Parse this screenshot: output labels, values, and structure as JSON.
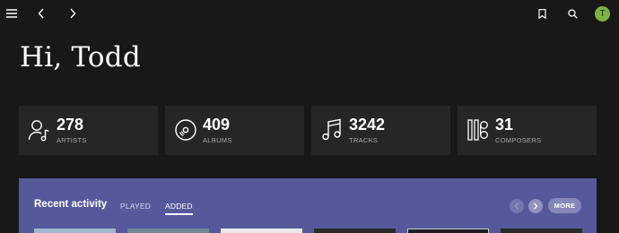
{
  "nav": {
    "menu_icon": "hamburger-icon",
    "back_icon": "chevron-left-icon",
    "forward_icon": "chevron-right-icon",
    "bookmark_icon": "bookmark-icon",
    "search_icon": "search-icon",
    "avatar_initial": "T",
    "avatar_color": "#7bb342"
  },
  "greeting": "Hi, Todd",
  "stats": [
    {
      "value": "278",
      "label": "ARTISTS",
      "icon": "artist-icon"
    },
    {
      "value": "409",
      "label": "ALBUMS",
      "icon": "album-disc-icon"
    },
    {
      "value": "3242",
      "label": "TRACKS",
      "icon": "music-note-icon"
    },
    {
      "value": "31",
      "label": "COMPOSERS",
      "icon": "composer-icon"
    }
  ],
  "activity": {
    "title": "Recent activity",
    "tabs": [
      {
        "label": "PLAYED",
        "active": false
      },
      {
        "label": "ADDED",
        "active": true
      }
    ],
    "more_label": "MORE",
    "background": "#55599c",
    "thumbnail_colors": [
      "#9fb7cc",
      "#6f8796",
      "#e9e9e9",
      "#2a2a2a",
      "#1c1c22",
      "#2b2b2b"
    ]
  }
}
